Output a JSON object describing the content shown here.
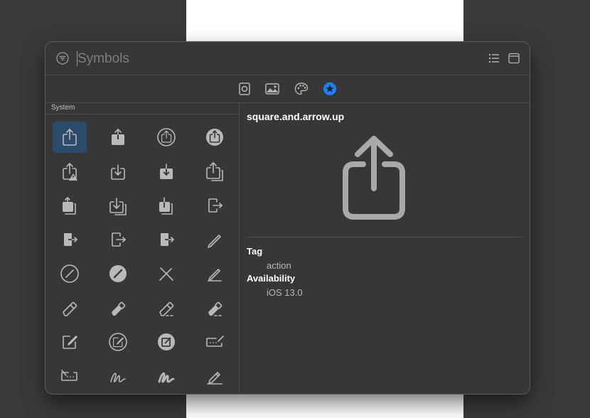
{
  "search": {
    "placeholder": "Symbols",
    "value": ""
  },
  "categories": [
    "photo-frame-icon",
    "photo-icon",
    "palette-icon",
    "favorites-icon"
  ],
  "colors": {
    "accent": "#1a82f8",
    "panel": "#373737",
    "selection": "#2b4a6c"
  },
  "sidebar": {
    "section_title": "System",
    "symbols": [
      "square.and.arrow.up",
      "square.and.arrow.up.fill",
      "square.and.arrow.up.circle",
      "square.and.arrow.up.circle.fill",
      "square.and.arrow.up.trianglebadge.exclamationmark",
      "square.and.arrow.down",
      "square.and.arrow.down.fill",
      "square.and.arrow.up.on.square",
      "square.and.arrow.up.on.square.fill",
      "square.and.arrow.down.on.square",
      "square.and.arrow.down.on.square.fill",
      "rectangle.portrait.and.arrow.right",
      "rectangle.portrait.and.arrow.right.fill",
      "rectangle.portrait.and.arrow.forward",
      "rectangle.portrait.and.arrow.forward.fill",
      "pencil",
      "pencil.circle",
      "pencil.circle.fill",
      "pencil.slash",
      "pencil.line",
      "eraser",
      "eraser.fill",
      "eraser.line.dashed",
      "eraser.line.dashed.fill",
      "square.and.pencil",
      "square.and.pencil.circle",
      "square.and.pencil.circle.fill",
      "rectangle.and.pencil.and.ellipsis",
      "rectangle.and.pencil.and.ellipsis.rtl",
      "scribble",
      "scribble.variable",
      "pencil.and.outline"
    ]
  },
  "detail": {
    "name": "square.and.arrow.up",
    "tag_label": "Tag",
    "tag_value": "action",
    "availability_label": "Availability",
    "availability_value": "iOS 13.0"
  }
}
